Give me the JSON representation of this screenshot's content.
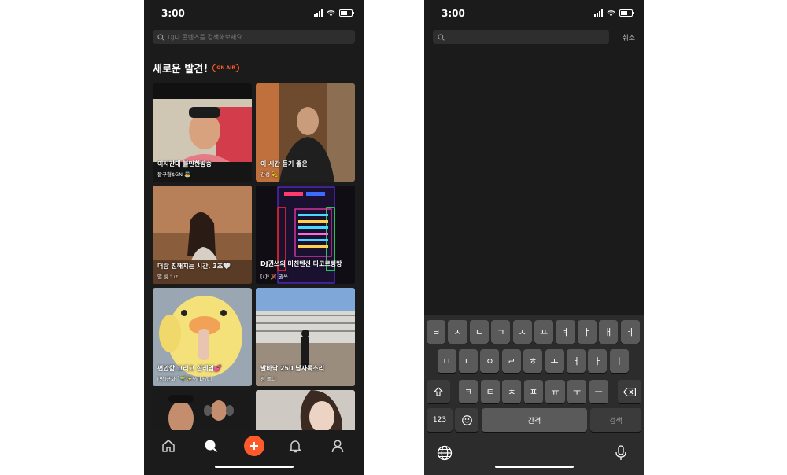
{
  "status": {
    "time": "3:00"
  },
  "left": {
    "search_placeholder": "DJ나 콘텐츠를 검색해보세요.",
    "section_title": "새로운 발견!",
    "on_air": "ON AIR",
    "cards": [
      {
        "title": "이시간대 불만한방송",
        "dj": "짭구형$GN 👼"
      },
      {
        "title": "이 시간 듣기 좋은",
        "dj": "강성 💫"
      },
      {
        "title": "더랑 친해지는 시간, 3초🤍",
        "dj": "별 빛 ' ᴊᴢ"
      },
      {
        "title": "DJ권쓰의 미친텐션 타코르팅방",
        "dj": "[♯]⁸ 🎉 권쓰"
      },
      {
        "title": "편안함 그리고 설레임💕",
        "dj": "[방]근화 ˚🌱✨⅓[LF/L]"
      },
      {
        "title": "발바닥 250 남자목소리",
        "dj": "정 쁘니"
      }
    ],
    "nav": [
      "home-icon",
      "search-icon",
      "plus-icon",
      "bell-icon",
      "profile-icon"
    ],
    "accent": "#ff5a2a"
  },
  "right": {
    "cancel": "취소",
    "keyboard": {
      "row1": [
        "ㅂ",
        "ㅈ",
        "ㄷ",
        "ㄱ",
        "ㅅ",
        "ㅛ",
        "ㅕ",
        "ㅑ",
        "ㅐ",
        "ㅔ"
      ],
      "row2": [
        "ㅁ",
        "ㄴ",
        "ㅇ",
        "ㄹ",
        "ㅎ",
        "ㅗ",
        "ㅓ",
        "ㅏ",
        "ㅣ"
      ],
      "row3": [
        "ㅋ",
        "ㅌ",
        "ㅊ",
        "ㅍ",
        "ㅠ",
        "ㅜ",
        "ㅡ"
      ],
      "numbers": "123",
      "space": "간격",
      "search": "검색"
    }
  }
}
